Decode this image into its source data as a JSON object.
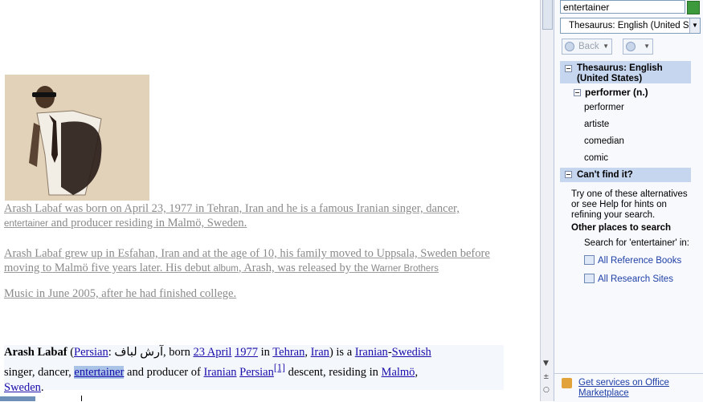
{
  "document": {
    "para1_a": "Arash Labaf was born on April 23, 1977 in Tehran, Iran and he is a famous Iranian singer, dancer, ",
    "para1_small": "entertainer",
    "para1_b": " and producer residing in Malmö, Sweden.",
    "para2_a": "Arash Labaf grew up in Esfahan, Iran and at the age of 10, his family moved to Uppsala, Sweden before moving to Malmö five years later. His debut ",
    "para2_small1": "album",
    "para2_b": ", Arash, was released by the ",
    "para2_small2": "Warner Brothers",
    "para3": "Music in June 2005, after he had finished college.",
    "wiki": {
      "name": "Arash Labaf",
      "open_paren": " (",
      "persian_link": "Persian",
      "colon": ": ",
      "persian_text": "آرش لباف",
      "born": ", born ",
      "date_link": "23 April",
      "year_link": "1977",
      "in": " in ",
      "tehran_link": "Tehran",
      "comma": ", ",
      "iran_link": "Iran",
      "is_a": ") is a ",
      "iranian_link": "Iranian",
      "dash": "-",
      "swedish_link": "Swedish",
      "line2": " singer, dancer, ",
      "entertainer_sel": "entertainer",
      "and_producer": " and producer of ",
      "iranian2_link": "Iranian",
      "persian2_link": "Persian",
      "ref": "[1]",
      "descent": " descent, residing in ",
      "malmo_link": "Malmö",
      "comma2": ",",
      "sweden_link": "Sweden",
      "period": "."
    }
  },
  "pane": {
    "search_value": "entertainer",
    "dropdown_value": "Thesaurus: English (United States)",
    "back_label": "Back",
    "section1_title": "Thesaurus: English (United States)",
    "sub_heading": "performer (n.)",
    "synonyms": [
      "performer",
      "artiste",
      "comedian",
      "comic"
    ],
    "section2_title": "Can't find it?",
    "hint": "Try one of these alternatives or see Help for hints on refining your search.",
    "other_places": "Other places to search",
    "search_for": "Search for 'entertainer' in:",
    "links": [
      "All Reference Books",
      "All Research Sites"
    ],
    "office_link": "Get services on Office Marketplace"
  },
  "icons": {
    "photo": "portrait-photo",
    "back": "back-arrow-icon",
    "forward": "forward-arrow-icon",
    "book": "reference-book-icon",
    "office": "office-marketplace-icon"
  }
}
